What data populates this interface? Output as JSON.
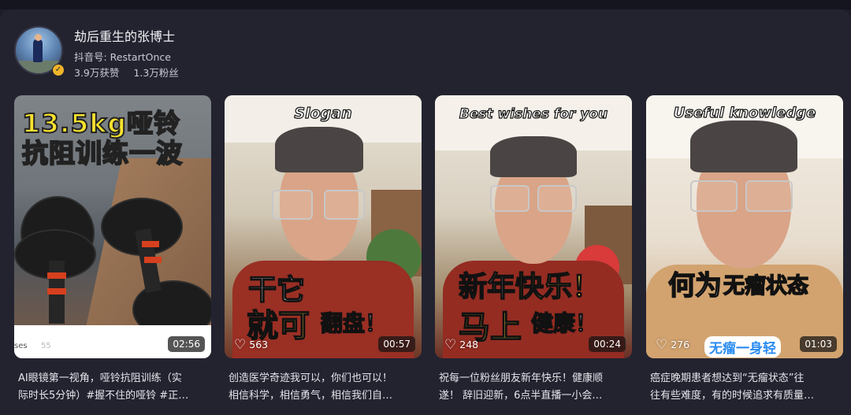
{
  "profile": {
    "name": "劫后重生的张博士",
    "douyin_id": "抖音号: RestartOnce",
    "likes": "3.9万获赞",
    "fans": "1.3万粉丝"
  },
  "videos": [
    {
      "overlay_lines": [
        "13.5kg哑铃",
        "抗阻训练一波"
      ],
      "bottom_left": "ses",
      "bottom_faint": "55",
      "duration": "02:56",
      "desc_lines": [
        "AI眼镜第一视角，哑铃抗阻训练（实",
        "际时长5分钟）#握不住的哑铃 #正…"
      ]
    },
    {
      "top_label": "Slogan",
      "overlay_line1": "干它",
      "overlay_line2a": "就可",
      "overlay_line2b": "翻盘！",
      "likes": "563",
      "duration": "00:57",
      "desc_lines": [
        "创造医学奇迹我可以，你们也可以！",
        "相信科学，相信勇气，相信我们自…"
      ]
    },
    {
      "top_label": "Best wishes for you",
      "overlay_line1a": "新年",
      "overlay_line1b": "快乐！",
      "overlay_line2a": "马上",
      "overlay_line2b": "健康！",
      "likes": "248",
      "duration": "00:24",
      "desc_lines": [
        "祝每一位粉丝朋友新年快乐！健康顺",
        "遂！ 辞旧迎新，6点半直播一小会…"
      ]
    },
    {
      "top_label": "Useful knowledge",
      "overlay_line1a": "何为",
      "overlay_line1b": "无瘤状态",
      "sticker": "无瘤一身轻",
      "likes": "276",
      "duration": "01:03",
      "desc_lines": [
        "癌症晚期患者想达到“无瘤状态”往",
        "往有些难度，有的时候追求有质量…"
      ]
    }
  ],
  "icons": {
    "verified": "verified-badge-icon",
    "like": "heart-icon"
  },
  "colors": {
    "page_bg": "#232330",
    "verified": "#f0b429",
    "overlay_yellow": "#f5d94a"
  }
}
